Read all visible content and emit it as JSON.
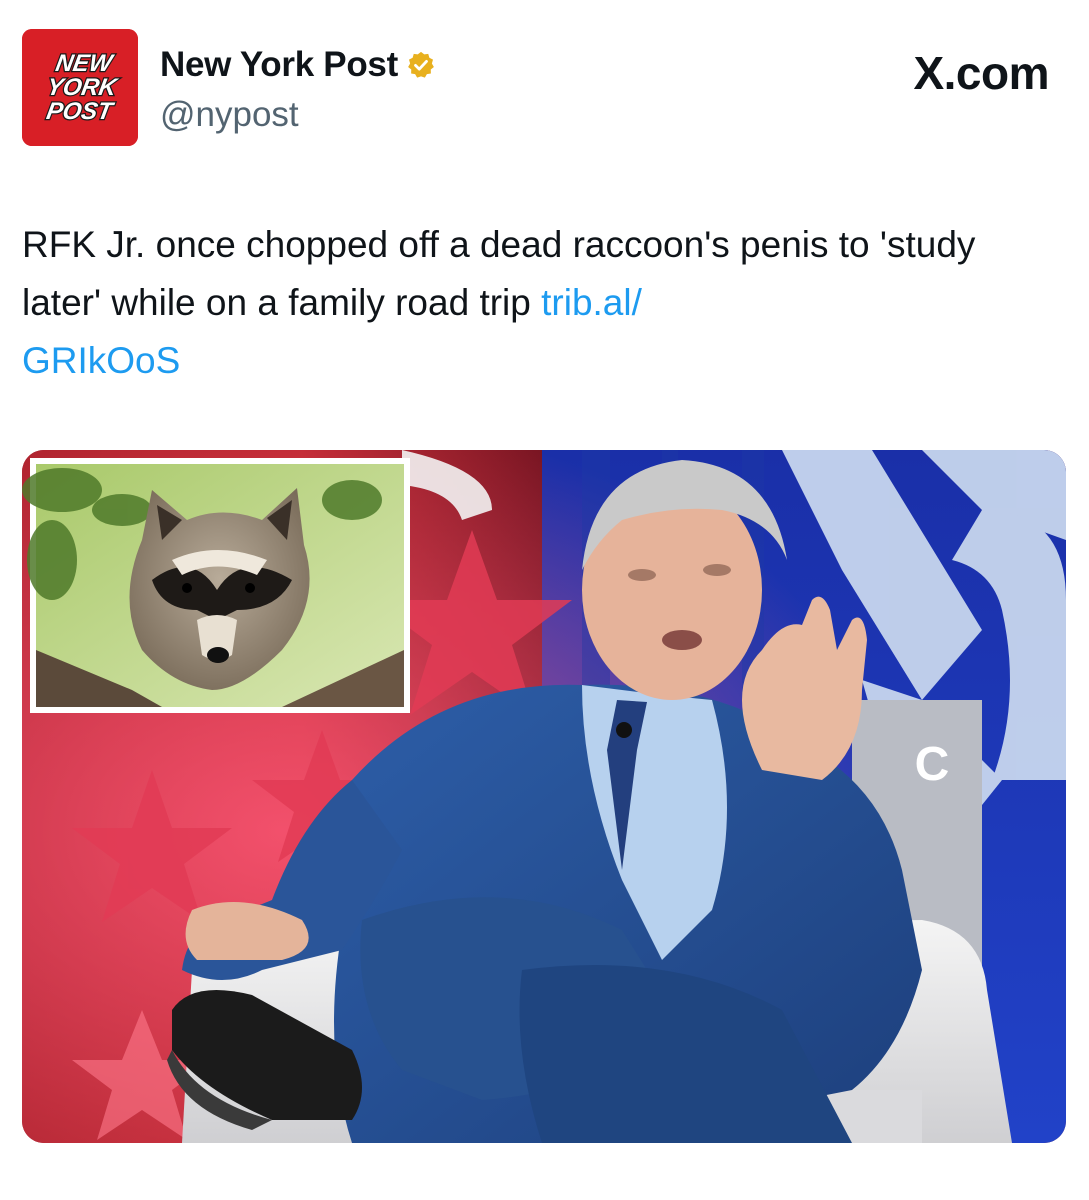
{
  "account": {
    "avatar_logo_lines": [
      "NEW",
      "YORK",
      "POST"
    ],
    "display_name": "New York Post",
    "handle": "@nypost",
    "verified_icon": "verified-badge-icon",
    "verified_color": "#e8b01e"
  },
  "source_label": "X.com",
  "tweet": {
    "text": "RFK Jr. once chopped off a dead raccoon's penis to 'study later' while on a family road trip ",
    "link_part1": "trib.al/",
    "link_part2": "GRIkOoS",
    "link_color": "#1d9bf0"
  },
  "media": {
    "inset_subject": "raccoon",
    "main_subject": "man seated in white armchair on stage",
    "stage_sign_letter": "C"
  }
}
